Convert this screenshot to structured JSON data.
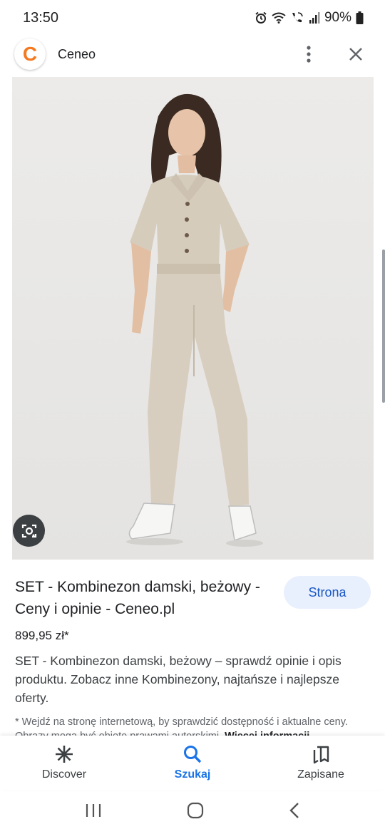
{
  "status_bar": {
    "time": "13:50",
    "battery": "90%",
    "icons": [
      "alarm-icon",
      "wifi-icon",
      "wifi-calling-icon",
      "signal-icon",
      "battery-icon"
    ]
  },
  "header": {
    "logo_letter": "C",
    "site_name": "Ceneo",
    "logo_color": "#f4791f",
    "icons": [
      "more-vert-icon",
      "close-icon"
    ]
  },
  "image": {
    "lens_icon": "google-lens-icon"
  },
  "result": {
    "title": "SET - Kombinezon damski, beżowy - Ceny i opinie - Ceneo.pl",
    "visit_button": "Strona",
    "price": "899,95 zł*",
    "description": "SET - Kombinezon damski, beżowy – sprawdź opinie i opis produktu. Zobacz inne Kombinezony, najtańsze i najlepsze oferty.",
    "note": "* Wejdź na stronę internetową, by sprawdzić dostępność i aktualne ceny. Obrazy mogą być objęte prawami autorskimi.",
    "note_link": "Więcej informacji"
  },
  "bottom_nav": [
    {
      "label": "Discover",
      "icon": "discover-asterisk-icon"
    },
    {
      "label": "Szukaj",
      "icon": "search-icon"
    },
    {
      "label": "Zapisane",
      "icon": "collections-icon"
    }
  ],
  "accent_color": "#1a73e8"
}
